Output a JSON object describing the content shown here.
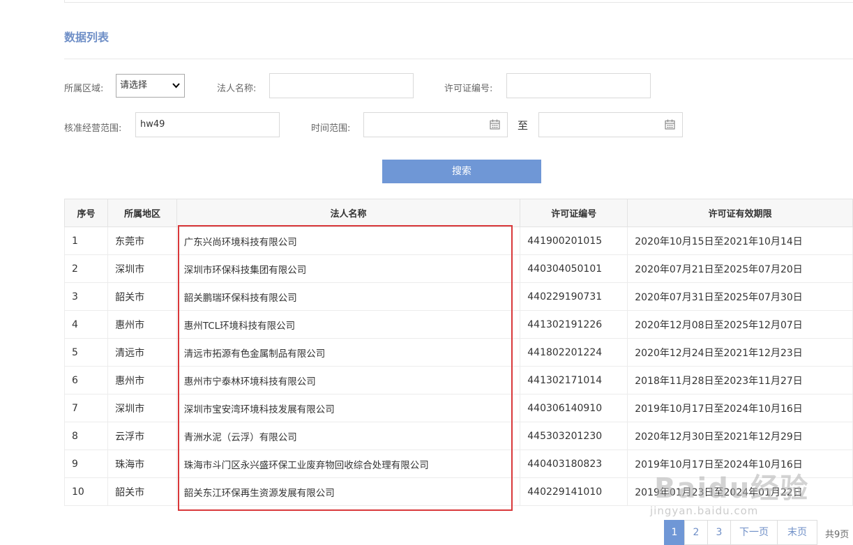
{
  "section": {
    "title": "数据列表"
  },
  "filters": {
    "region_label": "所属区域:",
    "region_value": "请选择",
    "legal_name_label": "法人名称:",
    "legal_name_value": "",
    "license_no_label": "许可证编号:",
    "license_no_value": "",
    "scope_label": "核准经营范围:",
    "scope_value": "hw49",
    "time_label": "时间范围:",
    "time_start": "",
    "time_end": "",
    "to_label": "至",
    "search_label": "搜索"
  },
  "table": {
    "headers": [
      "序号",
      "所属地区",
      "法人名称",
      "许可证编号",
      "许可证有效期限"
    ],
    "rows": [
      [
        "1",
        "东莞市",
        "广东兴尚环境科技有限公司",
        "441900201015",
        "2020年10月15日至2021年10月14日"
      ],
      [
        "2",
        "深圳市",
        "深圳市环保科技集团有限公司",
        "440304050101",
        "2020年07月21日至2025年07月20日"
      ],
      [
        "3",
        "韶关市",
        "韶关鹏瑞环保科技有限公司",
        "440229190731",
        "2020年07月31日至2025年07月30日"
      ],
      [
        "4",
        "惠州市",
        "惠州TCL环境科技有限公司",
        "441302191226",
        "2020年12月08日至2025年12月07日"
      ],
      [
        "5",
        "清远市",
        "清远市拓源有色金属制品有限公司",
        "441802201224",
        "2020年12月24日至2021年12月23日"
      ],
      [
        "6",
        "惠州市",
        "惠州市宁泰林环境科技有限公司",
        "441302171014",
        "2018年11月28日至2023年11月27日"
      ],
      [
        "7",
        "深圳市",
        "深圳市宝安湾环境科技发展有限公司",
        "440306140910",
        "2019年10月17日至2024年10月16日"
      ],
      [
        "8",
        "云浮市",
        "青洲水泥（云浮）有限公司",
        "445303201230",
        "2020年12月30日至2021年12月29日"
      ],
      [
        "9",
        "珠海市",
        "珠海市斗门区永兴盛环保工业废弃物回收综合处理有限公司",
        "440403180823",
        "2019年10月17日至2024年10月16日"
      ],
      [
        "10",
        "韶关市",
        "韶关东江环保再生资源发展有限公司",
        "440229141010",
        "2019年01月23日至2024年01月22日"
      ]
    ]
  },
  "pagination": {
    "pages": [
      "1",
      "2",
      "3"
    ],
    "current": "1",
    "next": "下一页",
    "last": "末页",
    "total": "共9页"
  },
  "watermark": {
    "logo": "Baidu经验",
    "sub": "jingyan.baidu.com"
  },
  "colors": {
    "accent": "#6f97d6",
    "link": "#6f8fc7",
    "highlight": "#d9383a"
  }
}
